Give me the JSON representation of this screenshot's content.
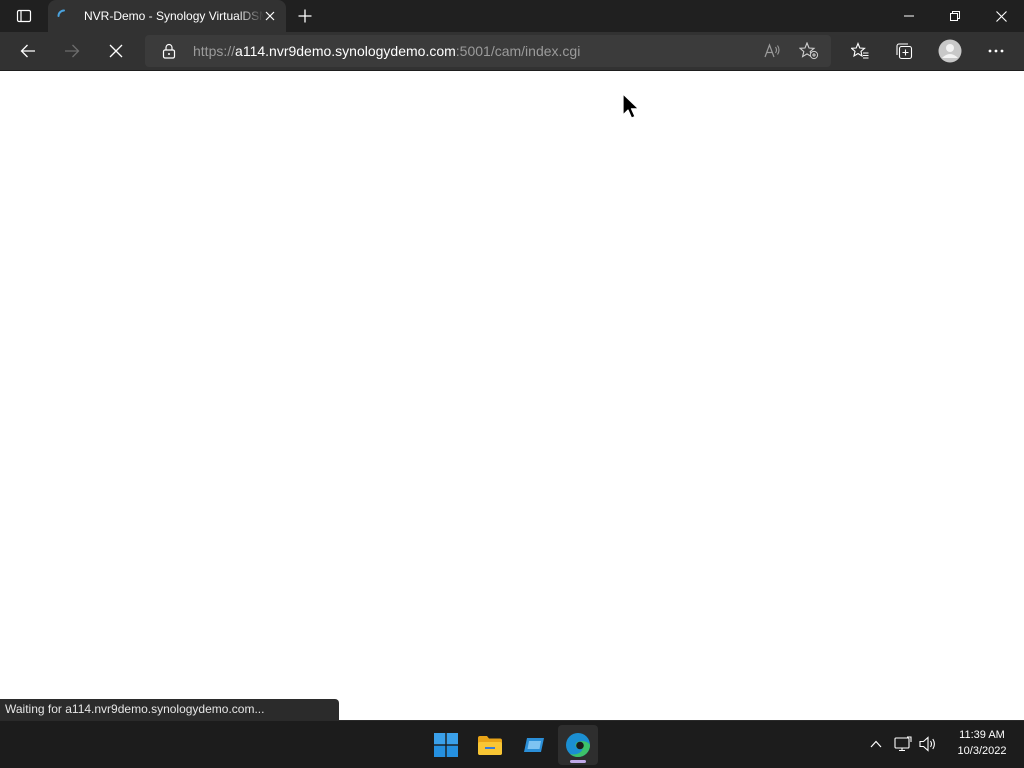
{
  "browser": {
    "tab": {
      "title": "NVR-Demo - Synology VirtualDSM"
    },
    "address": {
      "scheme": "https://",
      "host": "a114.nvr9demo.synologydemo.com",
      "path": ":5001/cam/index.cgi"
    },
    "status_text": "Waiting for a114.nvr9demo.synologydemo.com...",
    "icons": {
      "tab_actions": "tab-actions-icon",
      "spinner": "loading-spinner-icon",
      "tab_close": "close-icon",
      "new_tab": "plus-icon",
      "back": "back-arrow-icon",
      "forward": "forward-arrow-icon",
      "stop": "stop-loading-icon",
      "lock": "lock-icon",
      "read_aloud": "read-aloud-icon",
      "add_favorite": "star-add-icon",
      "favorites": "favorites-icon",
      "collections": "collections-icon",
      "profile": "profile-avatar-icon",
      "menu": "more-menu-icon"
    }
  },
  "taskbar": {
    "apps": [
      "start-icon",
      "file-explorer-icon",
      "storage-app-icon",
      "edge-icon"
    ],
    "tray": [
      "chevron-up-icon",
      "network-icon",
      "volume-icon"
    ],
    "time": "11:39 AM",
    "date": "10/3/2022"
  },
  "colors": {
    "titlebar": "#202020",
    "toolbar": "#323232",
    "addressbar": "#3b3b3b",
    "taskbar": "#1c1c1c",
    "spinner_accent": "#4aa3df",
    "edge_indicator": "#c0a9e8"
  }
}
